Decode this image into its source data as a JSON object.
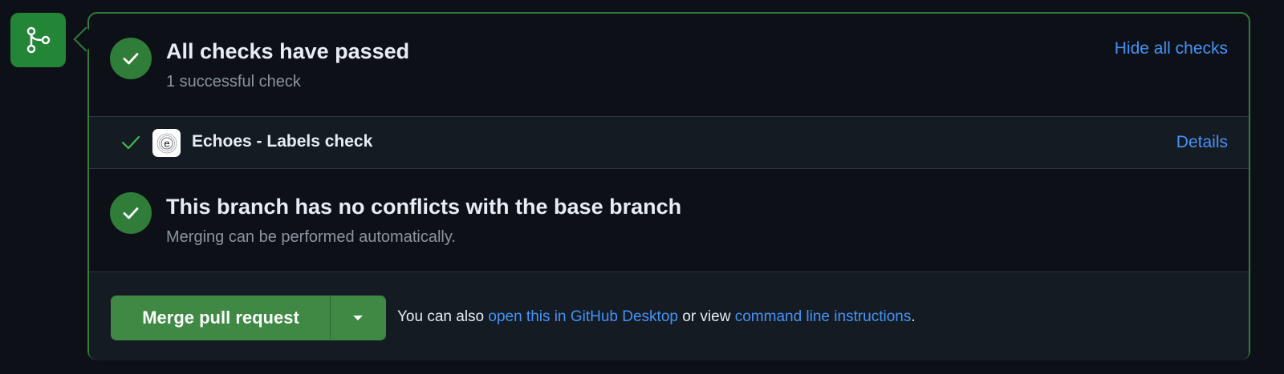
{
  "checks_summary": {
    "title": "All checks have passed",
    "subtitle": "1 successful check",
    "hide_link": "Hide all checks"
  },
  "check_items": [
    {
      "name": "Echoes - Labels check",
      "details_link": "Details",
      "logo_letter": "e"
    }
  ],
  "conflicts": {
    "title": "This branch has no conflicts with the base branch",
    "subtitle": "Merging can be performed automatically."
  },
  "merge": {
    "button_label": "Merge pull request",
    "text_prefix": "You can also ",
    "desktop_link": "open this in GitHub Desktop",
    "text_middle": " or view ",
    "cli_link": "command line instructions",
    "text_suffix": "."
  },
  "colors": {
    "background": "#0d1117",
    "success_green": "#2f7d38",
    "link_blue": "#4493f8",
    "muted_text": "#8b949e"
  }
}
